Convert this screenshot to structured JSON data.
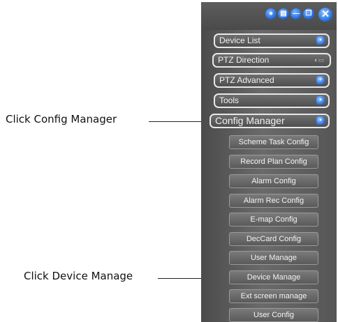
{
  "callouts": {
    "config_manager": "Click Config Manager",
    "device_manage": "Click Device Manage"
  },
  "panel": {
    "titlebar_buttons": [
      {
        "icon": "lock-icon",
        "glyph": "🔒"
      },
      {
        "icon": "save-icon",
        "glyph": "▤"
      },
      {
        "icon": "minimize-icon",
        "glyph": "—"
      },
      {
        "icon": "restore-icon",
        "glyph": "❐"
      },
      {
        "icon": "close-icon",
        "glyph": "✕"
      }
    ],
    "menus": {
      "device_list": "Device List",
      "ptz_direction": "PTZ Direction",
      "ptz_advanced": "PTZ Advanced",
      "tools": "Tools",
      "config_manager": "Config Manager"
    },
    "config_items": [
      "Scheme Task Config",
      "Record Plan Config",
      "Alarm Config",
      "Alarm Rec Config",
      "E-map Config",
      "DecCard Config",
      "User Manage",
      "Device Manage",
      "Ext screen manage",
      "User Config"
    ],
    "colors": {
      "accent": "#1c64d6",
      "panel": "#555555"
    }
  }
}
